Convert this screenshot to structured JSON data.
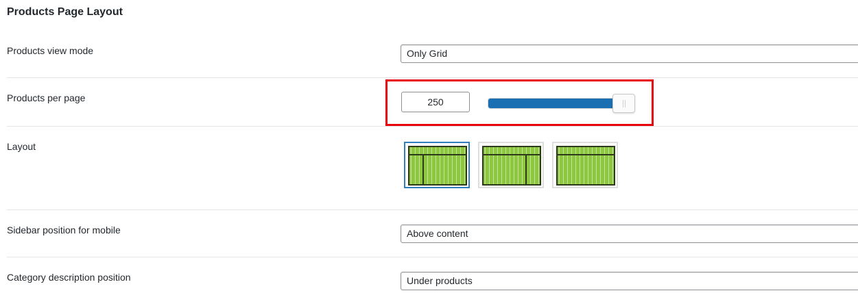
{
  "section": {
    "title": "Products Page Layout"
  },
  "rows": {
    "view_mode": {
      "label": "Products view mode",
      "value": "Only Grid"
    },
    "per_page": {
      "label": "Products per page",
      "value": "250",
      "slider_fraction": 0.9
    },
    "layout": {
      "label": "Layout",
      "options": [
        {
          "icon": "left-sidebar-layout-icon",
          "selected": true
        },
        {
          "icon": "right-sidebar-layout-icon",
          "selected": false
        },
        {
          "icon": "no-sidebar-layout-icon",
          "selected": false
        }
      ]
    },
    "sidebar_mobile": {
      "label": "Sidebar position for mobile",
      "value": "Above content"
    },
    "category_desc": {
      "label": "Category description position",
      "value": "Under products"
    }
  },
  "colors": {
    "highlight": "#e8000b",
    "slider_fill": "#1a6fb3",
    "layout_green": "#8dc63f",
    "selected_border": "#2f7fbe"
  }
}
